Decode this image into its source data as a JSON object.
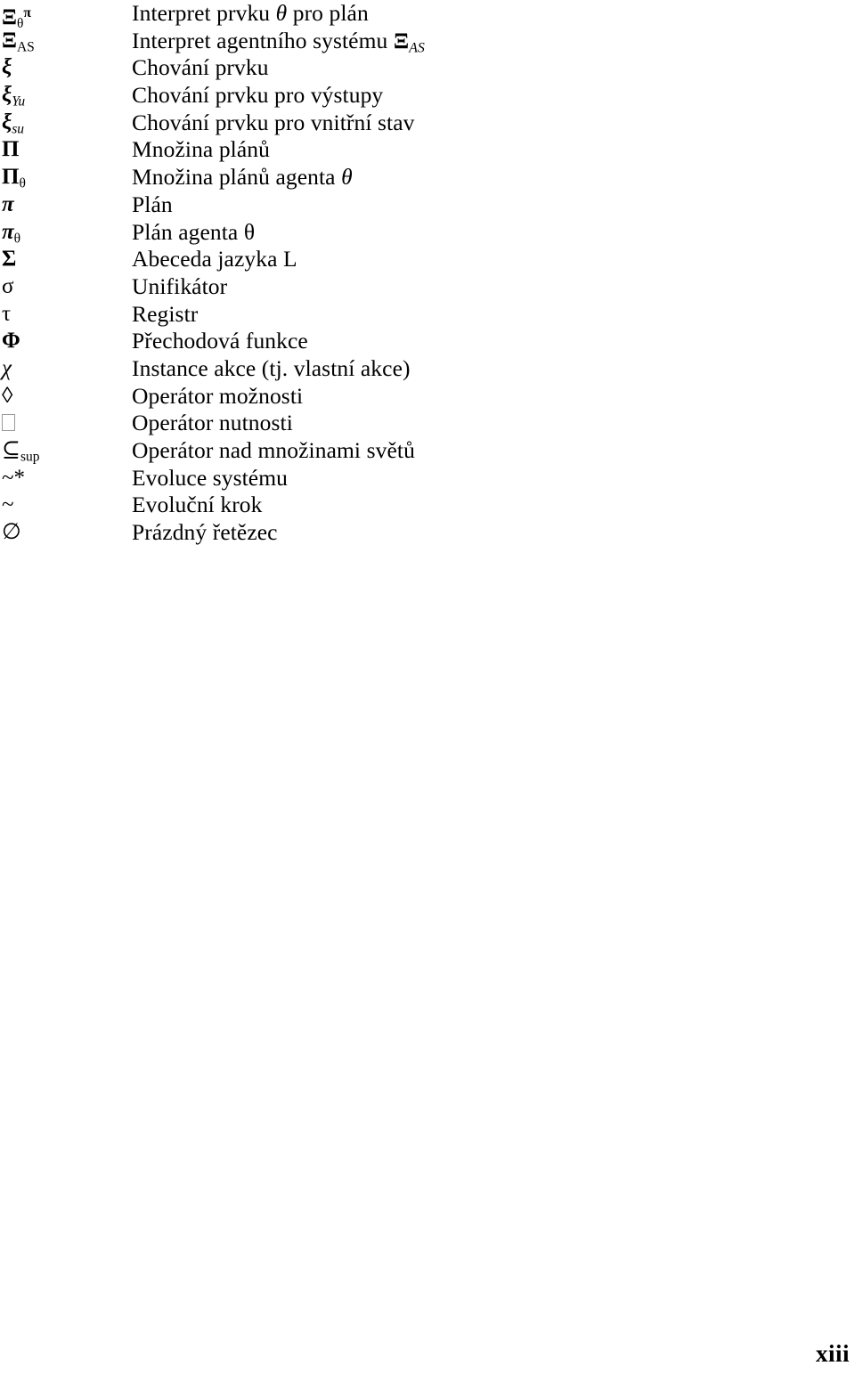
{
  "document": {
    "type": "symbol-glossary",
    "language": "cs",
    "page_number": "xiii"
  },
  "glossary": {
    "rows": [
      {
        "symbol_text": "Ξθπ",
        "symbol_base": "Ξ",
        "symbol_sub": "θ",
        "symbol_sup": "π",
        "description": "Interpret prvku θ pro plán",
        "description_prefix": "Interpret prvku ",
        "description_inline_symbol": "θ",
        "description_suffix": " pro plán"
      },
      {
        "symbol_text": "ΞAS",
        "symbol_base": "Ξ",
        "symbol_sub": "AS",
        "symbol_sup": "",
        "description": "Interpret agentního systému ΞAS",
        "description_prefix": "Interpret agentního systému ",
        "description_inline_symbol": "Ξ",
        "description_inline_sub": "AS",
        "description_suffix": ""
      },
      {
        "symbol_text": "ξ",
        "symbol_base": "ξ",
        "symbol_sub": "",
        "symbol_sup": "",
        "description": "Chování prvku"
      },
      {
        "symbol_text": "ξYu",
        "symbol_base": "ξ",
        "symbol_sub": "Yu",
        "symbol_sup": "",
        "description": "Chování prvku pro výstupy"
      },
      {
        "symbol_text": "ξsu",
        "symbol_base": "ξ",
        "symbol_sub": "su",
        "symbol_sup": "",
        "description": "Chování prvku pro vnitřní stav"
      },
      {
        "symbol_text": "Π",
        "symbol_base": "Π",
        "symbol_sub": "",
        "symbol_sup": "",
        "description": "Množina plánů"
      },
      {
        "symbol_text": "Πθ",
        "symbol_base": "Π",
        "symbol_sub": "θ",
        "symbol_sup": "",
        "description": "Množina plánů agenta θ",
        "description_prefix": "Množina plánů agenta ",
        "description_inline_symbol": "θ",
        "description_suffix": ""
      },
      {
        "symbol_text": "π",
        "symbol_base": "π",
        "symbol_sub": "",
        "symbol_sup": "",
        "description": "Plán"
      },
      {
        "symbol_text": "πθ",
        "symbol_base": "π",
        "symbol_sub": "θ",
        "symbol_sup": "",
        "description": "Plán agenta θ"
      },
      {
        "symbol_text": "Σ",
        "symbol_base": "Σ",
        "symbol_sub": "",
        "symbol_sup": "",
        "description": "Abeceda jazyka L"
      },
      {
        "symbol_text": "σ",
        "symbol_base": "σ",
        "symbol_sub": "",
        "symbol_sup": "",
        "description": "Unifikátor"
      },
      {
        "symbol_text": "τ",
        "symbol_base": "τ",
        "symbol_sub": "",
        "symbol_sup": "",
        "description": "Registr"
      },
      {
        "symbol_text": "Φ",
        "symbol_base": "Φ",
        "symbol_sub": "",
        "symbol_sup": "",
        "description": "Přechodová funkce"
      },
      {
        "symbol_text": "χ",
        "symbol_base": "χ",
        "symbol_sub": "",
        "symbol_sup": "",
        "description": "Instance akce (tj. vlastní akce)"
      },
      {
        "symbol_text": "◊",
        "symbol_base": "◊",
        "symbol_sub": "",
        "symbol_sup": "",
        "description": "Operátor možnosti"
      },
      {
        "symbol_text": "□",
        "symbol_base": "□",
        "symbol_sub": "",
        "symbol_sup": "",
        "description": "Operátor nutnosti"
      },
      {
        "symbol_text": "⊆sup",
        "symbol_base": "⊆",
        "symbol_sub": "sup",
        "symbol_sup": "",
        "description": "Operátor nad množinami světů"
      },
      {
        "symbol_text": "~*",
        "symbol_base": "~*",
        "symbol_sub": "",
        "symbol_sup": "",
        "description": "Evoluce systému"
      },
      {
        "symbol_text": "~",
        "symbol_base": "~",
        "symbol_sub": "",
        "symbol_sup": "",
        "description": "Evoluční krok"
      },
      {
        "symbol_text": "∅",
        "symbol_base": "∅",
        "symbol_sub": "",
        "symbol_sup": "",
        "description": "Prázdný řetězec"
      }
    ]
  }
}
